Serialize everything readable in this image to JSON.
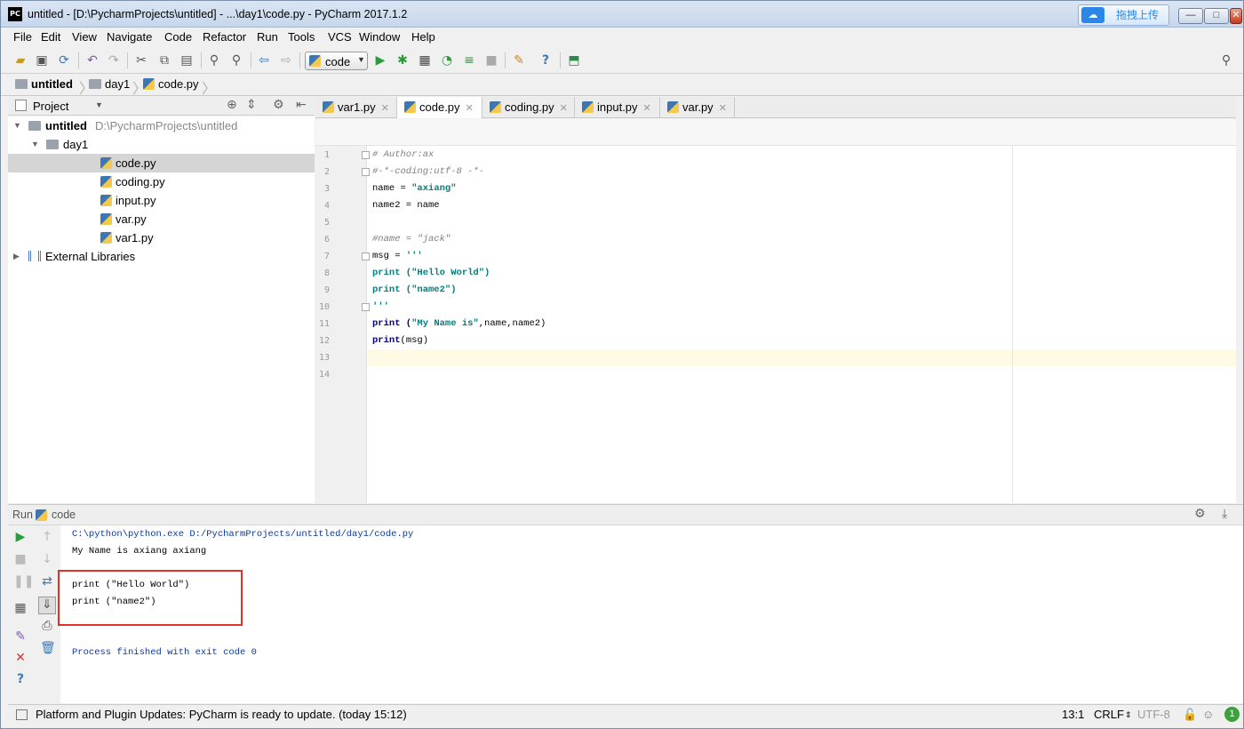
{
  "window": {
    "title": "untitled - [D:\\PycharmProjects\\untitled] - ...\\day1\\code.py - PyCharm 2017.1.2",
    "app_icon": "PC",
    "upload_button": "拖拽上传",
    "controls": {
      "minimize": "—",
      "maximize": "□",
      "close": "✕"
    }
  },
  "menu": [
    "File",
    "Edit",
    "View",
    "Navigate",
    "Code",
    "Refactor",
    "Run",
    "Tools",
    "VCS",
    "Window",
    "Help"
  ],
  "toolbar": {
    "run_config": "code"
  },
  "breadcrumb": [
    "untitled",
    "day1",
    "code.py"
  ],
  "project": {
    "header": "Project",
    "tree": [
      {
        "label": "untitled",
        "extra": "D:\\PycharmProjects\\untitled",
        "kind": "folder",
        "level": 0,
        "expanded": true
      },
      {
        "label": "day1",
        "kind": "folder",
        "level": 1,
        "expanded": true
      },
      {
        "label": "code.py",
        "kind": "py",
        "level": 2,
        "selected": true
      },
      {
        "label": "coding.py",
        "kind": "py",
        "level": 2
      },
      {
        "label": "input.py",
        "kind": "py",
        "level": 2
      },
      {
        "label": "var.py",
        "kind": "py",
        "level": 2
      },
      {
        "label": "var1.py",
        "kind": "py",
        "level": 2
      },
      {
        "label": "External Libraries",
        "kind": "lib",
        "level": 0,
        "expanded": false
      }
    ]
  },
  "tabs": [
    {
      "label": "var1.py",
      "active": false
    },
    {
      "label": "code.py",
      "active": true
    },
    {
      "label": "coding.py",
      "active": false
    },
    {
      "label": "input.py",
      "active": false
    },
    {
      "label": "var.py",
      "active": false
    }
  ],
  "editor": {
    "current_line": 13,
    "lines": [
      [
        {
          "t": "# Author:ax",
          "c": "cm"
        }
      ],
      [
        {
          "t": "#-*-coding:utf-8 -*-",
          "c": "cm"
        }
      ],
      [
        {
          "t": "name = ",
          "c": ""
        },
        {
          "t": "\"axiang\"",
          "c": "str"
        }
      ],
      [
        {
          "t": "name2 = name",
          "c": ""
        }
      ],
      [],
      [
        {
          "t": "#name = \"jack\"",
          "c": "cm"
        }
      ],
      [
        {
          "t": "msg = ",
          "c": ""
        },
        {
          "t": "'''",
          "c": "str"
        }
      ],
      [
        {
          "t": "print (\"Hello World\")",
          "c": "str"
        }
      ],
      [
        {
          "t": "print (\"name2\")",
          "c": "str"
        }
      ],
      [
        {
          "t": "'''",
          "c": "str"
        }
      ],
      [
        {
          "t": "print (",
          "c": "kw"
        },
        {
          "t": "\"My Name is\"",
          "c": "str"
        },
        {
          "t": ",name,name2)",
          "c": ""
        }
      ],
      [
        {
          "t": "print",
          "c": "kw"
        },
        {
          "t": "(msg)",
          "c": ""
        }
      ],
      [],
      []
    ]
  },
  "run": {
    "label": "Run",
    "config": "code",
    "output": [
      "C:\\python\\python.exe D:/PycharmProjects/untitled/day1/code.py",
      "My Name is axiang axiang",
      "",
      "print (\"Hello World\")",
      "print (\"name2\")",
      "",
      "",
      "Process finished with exit code 0"
    ]
  },
  "status": {
    "message": "Platform and Plugin Updates: PyCharm is ready to update. (today 15:12)",
    "position": "13:1",
    "line_sep": "CRLF",
    "encoding": "UTF-8",
    "badge": "1"
  }
}
